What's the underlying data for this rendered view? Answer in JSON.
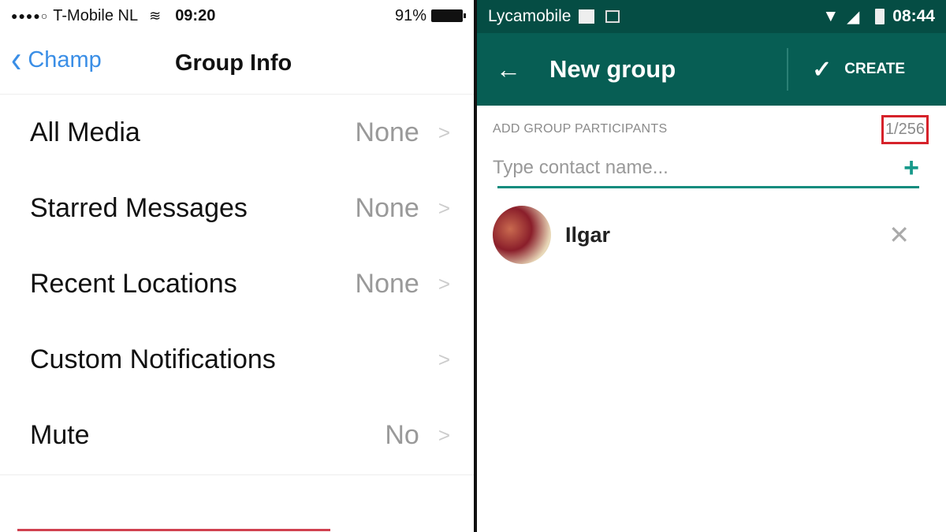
{
  "ios": {
    "status": {
      "signal_dots": "●●●●○",
      "carrier": "T-Mobile NL",
      "wifi_icon": "wifi-icon",
      "time": "09:20",
      "battery": "91%"
    },
    "nav": {
      "back_label": "Champ",
      "title": "Group Info"
    },
    "rows": [
      {
        "label": "All Media",
        "value": "None"
      },
      {
        "label": "Starred Messages",
        "value": "None"
      },
      {
        "label": "Recent Locations",
        "value": "None"
      },
      {
        "label": "Custom Notifications",
        "value": ""
      },
      {
        "label": "Mute",
        "value": "No"
      }
    ]
  },
  "android": {
    "status": {
      "carrier": "Lycamobile",
      "time": "08:44"
    },
    "toolbar": {
      "title": "New group",
      "create_label": "CREATE"
    },
    "section": {
      "header": "ADD GROUP PARTICIPANTS",
      "count": "1/256"
    },
    "search": {
      "placeholder": "Type contact name..."
    },
    "participants": [
      {
        "name": "Ilgar"
      }
    ],
    "colors": {
      "primary": "#075e54",
      "status_bar": "#054d44",
      "accent": "#128c7e",
      "highlight": "#d6222a"
    }
  }
}
